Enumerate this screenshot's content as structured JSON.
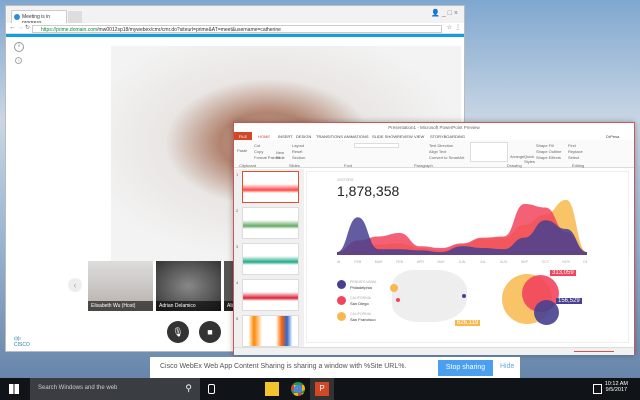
{
  "browser": {
    "tab_title": "Meeting is in progress...",
    "url_scheme": "https://",
    "url_host": "prime.domain.com",
    "url_path": "/mw0012sp18/mywebex/cmr/cmr.do?siteurl=prime&AT=meet&username=catherine",
    "window_controls": [
      "👤",
      "_",
      "□",
      "×"
    ]
  },
  "webex": {
    "participants": [
      {
        "name": "Elisabeth Wu (Host)"
      },
      {
        "name": "Adrian Delamico"
      },
      {
        "name": "Alis"
      }
    ],
    "logo": "cisco",
    "controls": [
      "mute-button",
      "video-button"
    ]
  },
  "ppt": {
    "title": "Presentation1 - Microsoft PowerPoint Preview",
    "tabs": [
      "FILE",
      "HOME",
      "INSERT",
      "DESIGN",
      "TRANSITIONS",
      "ANIMATIONS",
      "SLIDE SHOW",
      "REVIEW",
      "VIEW",
      "STORYBOARDING"
    ],
    "user": "DrPesa",
    "groups": [
      "Clipboard",
      "Slides",
      "Font",
      "Paragraph",
      "Drawing",
      "Editing"
    ],
    "ribbon_items": {
      "paste": "Paste",
      "cut": "Cut",
      "copy": "Copy",
      "format_painter": "Format Painter",
      "new_slide": "New Slide",
      "layout": "Layout",
      "reset": "Reset",
      "section": "Section",
      "text_direction": "Text Direction",
      "align_text": "Align Text",
      "convert_smartart": "Convert to SmartArt",
      "arrange": "Arrange",
      "quick_styles": "Quick Styles",
      "shape_fill": "Shape Fill",
      "shape_outline": "Shape Outline",
      "shape_effects": "Shape Effects",
      "find": "Find",
      "replace": "Replace",
      "select": "Select"
    },
    "slide_numbers": [
      "1",
      "2",
      "3",
      "4",
      "5"
    ]
  },
  "chart_data": {
    "type": "area",
    "label": "VISITORS",
    "total": "1,878,358",
    "categories": [
      "JAN",
      "FEB",
      "MAR",
      "FEB",
      "APR",
      "MAY",
      "JUN",
      "JUL",
      "AUG",
      "SEP",
      "OCT",
      "NOV",
      "DEC"
    ],
    "series": [
      {
        "name": "CALIFORNIA San Francisco",
        "color": "#f8b84e",
        "values": [
          5,
          15,
          18,
          20,
          12,
          8,
          18,
          28,
          30,
          52,
          70,
          95,
          5
        ]
      },
      {
        "name": "CALIFORNIA San Diego",
        "color": "#f2445d",
        "values": [
          5,
          25,
          32,
          38,
          15,
          12,
          20,
          30,
          32,
          88,
          82,
          40,
          5
        ]
      },
      {
        "name": "PENNSYLVANIA Philadelphia",
        "color": "#47408f",
        "values": [
          5,
          65,
          10,
          10,
          8,
          5,
          15,
          12,
          10,
          30,
          60,
          45,
          5
        ]
      }
    ],
    "legend": [
      {
        "state": "PENNSYLVANIA",
        "city": "Philadelphia",
        "color": "#47408f"
      },
      {
        "state": "CALIFORNIA",
        "city": "San Diego",
        "color": "#f2445d"
      },
      {
        "state": "CALIFORNIA",
        "city": "San Francisco",
        "color": "#f8b84e"
      }
    ],
    "bubbles": [
      {
        "value": "626,119",
        "color": "#f8b84e"
      },
      {
        "value": "313,059",
        "color": "#f2445d"
      },
      {
        "value": "156,529",
        "color": "#47408f"
      }
    ]
  },
  "notification": {
    "message": "Cisco WebEx Web App Content Sharing is sharing a window with %Site URL%.",
    "stop": "Stop sharing",
    "hide": "Hide"
  },
  "taskbar": {
    "search_placeholder": "Search Windows and the web",
    "time": "10:12 AM",
    "date": "9/5/2017"
  }
}
